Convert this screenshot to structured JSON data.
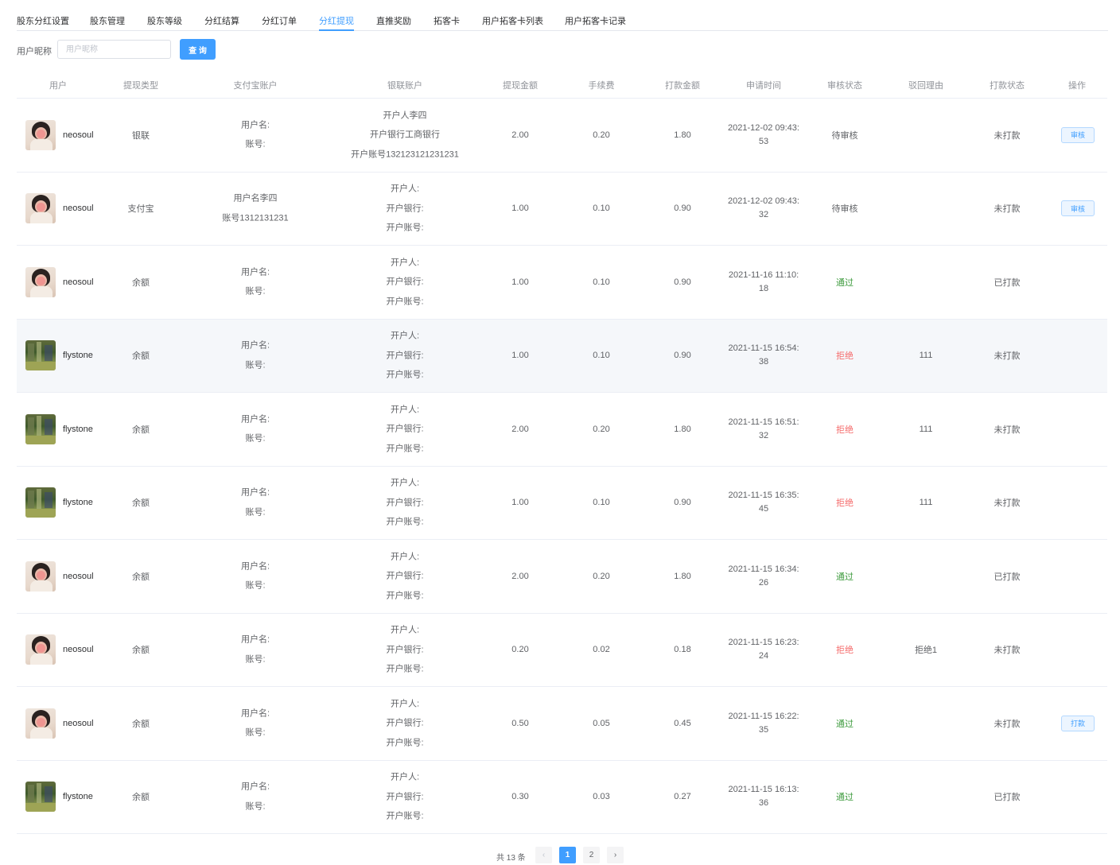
{
  "tabs": [
    {
      "label": "股东分红设置"
    },
    {
      "label": "股东管理"
    },
    {
      "label": "股东等级"
    },
    {
      "label": "分红结算"
    },
    {
      "label": "分红订单"
    },
    {
      "label": "分红提现"
    },
    {
      "label": "直推奖励"
    },
    {
      "label": "拓客卡"
    },
    {
      "label": "用户拓客卡列表"
    },
    {
      "label": "用户拓客卡记录"
    }
  ],
  "active_tab": "分红提现",
  "search": {
    "label": "用户昵称",
    "placeholder": "用户昵称",
    "value": "",
    "button_label": "查 询"
  },
  "columns": [
    "用户",
    "提现类型",
    "支付宝账户",
    "银联账户",
    "提现金额",
    "手续费",
    "打款金额",
    "申请时间",
    "审核状态",
    "驳回理由",
    "打款状态",
    "操作"
  ],
  "labels": {
    "alipay_name": "用户名:",
    "alipay_account": "账号:",
    "bank_holder": "开户人:",
    "bank_name": "开户银行:",
    "bank_account": "开户账号:"
  },
  "rows": [
    {
      "user": "neosoul",
      "avatar": "neosoul",
      "type": "银联",
      "alipay_name": "",
      "alipay_account": "",
      "bank_holder": "李四",
      "bank_name": "工商银行",
      "bank_account": "132123121231231",
      "amount": "2.00",
      "fee": "0.20",
      "paid": "1.80",
      "time_line1": "2021-12-02 09:43:",
      "time_line2": "53",
      "review": "待审核",
      "review_color": "pending",
      "reason": "",
      "pay_status": "未打款",
      "action": "审核"
    },
    {
      "user": "neosoul",
      "avatar": "neosoul",
      "type": "支付宝",
      "alipay_name": "李四",
      "alipay_account": "1312131231",
      "bank_holder": "",
      "bank_name": "",
      "bank_account": "",
      "amount": "1.00",
      "fee": "0.10",
      "paid": "0.90",
      "time_line1": "2021-12-02 09:43:",
      "time_line2": "32",
      "review": "待审核",
      "review_color": "pending",
      "reason": "",
      "pay_status": "未打款",
      "action": "审核"
    },
    {
      "user": "neosoul",
      "avatar": "neosoul",
      "type": "余额",
      "alipay_name": "",
      "alipay_account": "",
      "bank_holder": "",
      "bank_name": "",
      "bank_account": "",
      "amount": "1.00",
      "fee": "0.10",
      "paid": "0.90",
      "time_line1": "2021-11-16 11:10:",
      "time_line2": "18",
      "review": "通过",
      "review_color": "pass",
      "reason": "",
      "pay_status": "已打款",
      "action": ""
    },
    {
      "user": "flystone",
      "avatar": "flystone",
      "type": "余额",
      "alipay_name": "",
      "alipay_account": "",
      "bank_holder": "",
      "bank_name": "",
      "bank_account": "",
      "amount": "1.00",
      "fee": "0.10",
      "paid": "0.90",
      "time_line1": "2021-11-15 16:54:",
      "time_line2": "38",
      "review": "拒绝",
      "review_color": "reject",
      "reason": "111",
      "pay_status": "未打款",
      "action": "",
      "hover": true
    },
    {
      "user": "flystone",
      "avatar": "flystone",
      "type": "余额",
      "alipay_name": "",
      "alipay_account": "",
      "bank_holder": "",
      "bank_name": "",
      "bank_account": "",
      "amount": "2.00",
      "fee": "0.20",
      "paid": "1.80",
      "time_line1": "2021-11-15 16:51:",
      "time_line2": "32",
      "review": "拒绝",
      "review_color": "reject",
      "reason": "111",
      "pay_status": "未打款",
      "action": ""
    },
    {
      "user": "flystone",
      "avatar": "flystone",
      "type": "余额",
      "alipay_name": "",
      "alipay_account": "",
      "bank_holder": "",
      "bank_name": "",
      "bank_account": "",
      "amount": "1.00",
      "fee": "0.10",
      "paid": "0.90",
      "time_line1": "2021-11-15 16:35:",
      "time_line2": "45",
      "review": "拒绝",
      "review_color": "reject",
      "reason": "111",
      "pay_status": "未打款",
      "action": ""
    },
    {
      "user": "neosoul",
      "avatar": "neosoul",
      "type": "余额",
      "alipay_name": "",
      "alipay_account": "",
      "bank_holder": "",
      "bank_name": "",
      "bank_account": "",
      "amount": "2.00",
      "fee": "0.20",
      "paid": "1.80",
      "time_line1": "2021-11-15 16:34:",
      "time_line2": "26",
      "review": "通过",
      "review_color": "pass",
      "reason": "",
      "pay_status": "已打款",
      "action": ""
    },
    {
      "user": "neosoul",
      "avatar": "neosoul",
      "type": "余额",
      "alipay_name": "",
      "alipay_account": "",
      "bank_holder": "",
      "bank_name": "",
      "bank_account": "",
      "amount": "0.20",
      "fee": "0.02",
      "paid": "0.18",
      "time_line1": "2021-11-15 16:23:",
      "time_line2": "24",
      "review": "拒绝",
      "review_color": "reject",
      "reason": "拒绝1",
      "pay_status": "未打款",
      "action": ""
    },
    {
      "user": "neosoul",
      "avatar": "neosoul",
      "type": "余额",
      "alipay_name": "",
      "alipay_account": "",
      "bank_holder": "",
      "bank_name": "",
      "bank_account": "",
      "amount": "0.50",
      "fee": "0.05",
      "paid": "0.45",
      "time_line1": "2021-11-15 16:22:",
      "time_line2": "35",
      "review": "通过",
      "review_color": "pass",
      "reason": "",
      "pay_status": "未打款",
      "action": "打款"
    },
    {
      "user": "flystone",
      "avatar": "flystone",
      "type": "余额",
      "alipay_name": "",
      "alipay_account": "",
      "bank_holder": "",
      "bank_name": "",
      "bank_account": "",
      "amount": "0.30",
      "fee": "0.03",
      "paid": "0.27",
      "time_line1": "2021-11-15 16:13:",
      "time_line2": "36",
      "review": "通过",
      "review_color": "pass",
      "reason": "",
      "pay_status": "已打款",
      "action": ""
    }
  ],
  "pagination": {
    "total_text": "共 13 条",
    "pages": [
      "1",
      "2"
    ],
    "current": "1",
    "prev_icon": "chevron-left-icon",
    "next_icon": "chevron-right-icon",
    "prev_glyph": "‹",
    "next_glyph": "›"
  },
  "colors": {
    "accent": "#409eff",
    "pass": "#3c9a3c",
    "reject": "#f56c6c",
    "pending": "#606266"
  }
}
